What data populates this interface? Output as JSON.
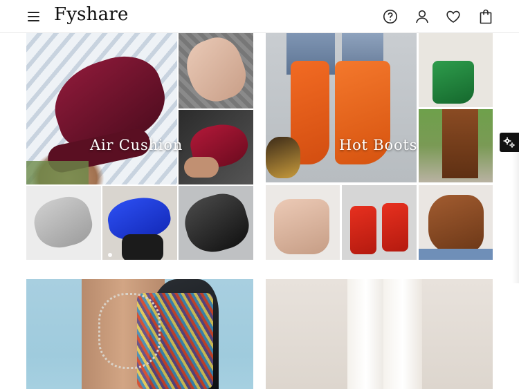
{
  "header": {
    "brand": "Fyshare",
    "icons": [
      "menu-icon",
      "help-icon",
      "account-icon",
      "heart-icon",
      "bag-icon"
    ]
  },
  "categories": [
    {
      "label": "Air Cushion"
    },
    {
      "label": "Hot Boots"
    },
    {
      "label": ""
    },
    {
      "label": ""
    }
  ],
  "colors": {
    "header_border": "#e6e6e6",
    "widget_bg": "#111111",
    "text": "#111111"
  }
}
